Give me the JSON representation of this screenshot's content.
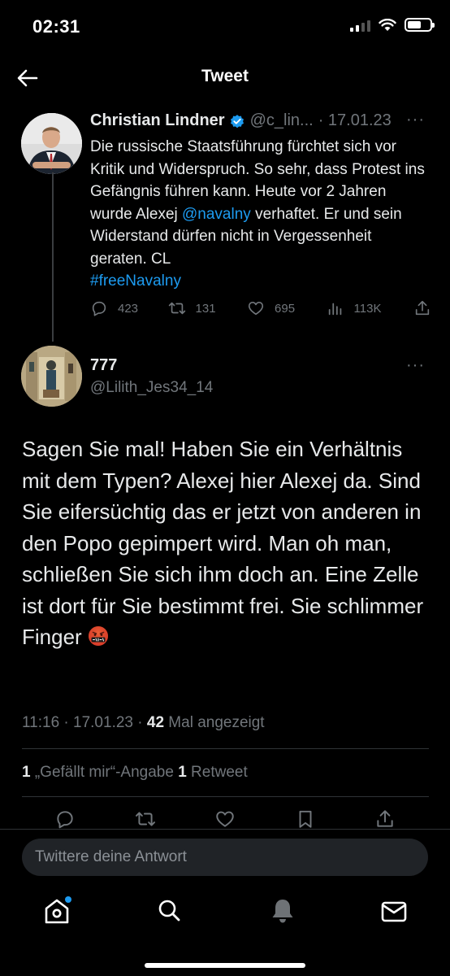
{
  "status_bar": {
    "time": "02:31"
  },
  "header": {
    "title": "Tweet"
  },
  "quoted_tweet": {
    "name": "Christian Lindner",
    "handle": "@c_lin...",
    "date": "· 17.01.23",
    "more": "···",
    "text_before_mention": "Die russische Staatsführung fürchtet sich vor Kritik und Widerspruch. So sehr, dass Protest ins Gefängnis führen kann. Heute vor 2 Jahren wurde Alexej ",
    "mention": "@navalny",
    "text_after_mention": " verhaftet. Er und sein Widerstand dürfen nicht in Vergessenheit geraten. CL",
    "hashtag": "#freeNavalny",
    "replies": "423",
    "retweets": "131",
    "likes": "695",
    "views": "113K"
  },
  "reply_tweet": {
    "name": "777",
    "handle": "@Lilith_Jes34_14",
    "more": "···",
    "text": "Sagen Sie mal! Haben Sie ein Verhältnis mit dem Typen? Alexej hier Alexej da. Sind Sie eifersüchtig das er jetzt von anderen in den Popo gepimpert wird. Man oh man, schließen Sie sich ihm doch an. Eine Zelle ist dort für Sie bestimmt frei. Sie schlimmer Finger",
    "emoji": "face-with-symbols-on-mouth",
    "time": "11:16 · 17.01.23 · ",
    "view_count": "42",
    "view_label": " Mal angezeigt",
    "likes_count": "1",
    "likes_label": " „Gefällt mir“-Angabe ",
    "retweets_count": "1",
    "retweets_label": " Retweet"
  },
  "reply_bar": {
    "placeholder": "Twittere deine Antwort"
  },
  "colors": {
    "accent": "#1d9bf0",
    "background": "#000000",
    "muted": "#71767b",
    "text": "#e7e9ea"
  }
}
